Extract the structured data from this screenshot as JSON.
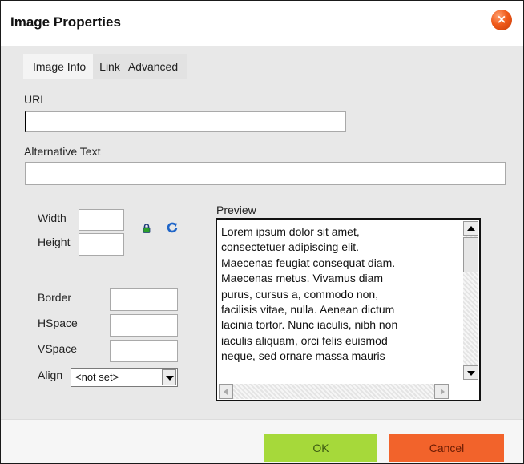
{
  "dialog": {
    "title": "Image Properties",
    "close_icon": "close-icon"
  },
  "tabs": [
    {
      "label": "Image Info",
      "active": true
    },
    {
      "label": "Link",
      "active": false
    },
    {
      "label": "Advanced",
      "active": false
    }
  ],
  "fields": {
    "url": {
      "label": "URL",
      "value": ""
    },
    "alt_text": {
      "label": "Alternative Text",
      "value": ""
    },
    "width": {
      "label": "Width",
      "value": ""
    },
    "height": {
      "label": "Height",
      "value": ""
    },
    "border": {
      "label": "Border",
      "value": ""
    },
    "hspace": {
      "label": "HSpace",
      "value": ""
    },
    "vspace": {
      "label": "VSpace",
      "value": ""
    },
    "align": {
      "label": "Align",
      "selected": "<not set>"
    }
  },
  "icons": {
    "lock": "lock-icon",
    "reset_size": "reset-size-icon"
  },
  "preview": {
    "label": "Preview",
    "lines": [
      "Lorem ipsum dolor sit amet,",
      "consectetuer adipiscing elit.",
      "Maecenas feugiat consequat diam.",
      "Maecenas metus. Vivamus diam",
      "purus, cursus a, commodo non,",
      "facilisis vitae, nulla. Aenean dictum",
      "lacinia tortor. Nunc iaculis, nibh non",
      "iaculis aliquam, orci felis euismod",
      "neque, sed ornare massa mauris"
    ]
  },
  "buttons": {
    "ok": "OK",
    "cancel": "Cancel"
  },
  "colors": {
    "ok": "#a6d93a",
    "cancel": "#f2632b",
    "close": "#f05a1a"
  }
}
